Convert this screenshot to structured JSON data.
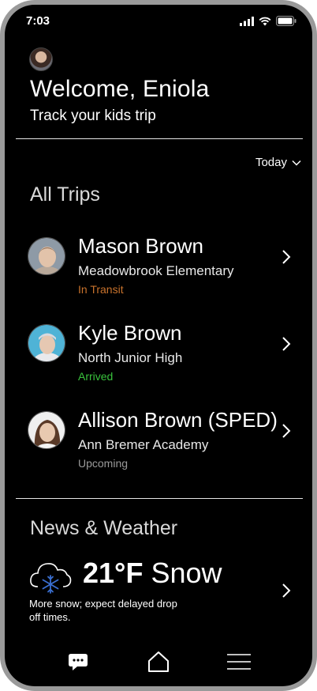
{
  "status_bar": {
    "time": "7:03"
  },
  "header": {
    "welcome": "Welcome, Eniola",
    "subtitle": "Track your kids trip"
  },
  "filter": {
    "label": "Today"
  },
  "trips_section": {
    "title": "All Trips",
    "trips": [
      {
        "name": "Mason Brown",
        "school": "Meadowbrook Elementary",
        "status": "In Transit",
        "status_color": "#c8722c"
      },
      {
        "name": "Kyle Brown",
        "school": "North Junior High",
        "status": "Arrived",
        "status_color": "#39c23c"
      },
      {
        "name": "Allison Brown (SPED)",
        "school": "Ann Bremer Academy",
        "status": "Upcoming",
        "status_color": "#9a9a9a"
      }
    ]
  },
  "news_section": {
    "title": "News & Weather",
    "weather": {
      "temperature": "21°F",
      "condition": "Snow",
      "description": "More snow; expect delayed drop off times.",
      "icon": "cloud-snow-icon"
    }
  },
  "bottom_nav": {
    "items": [
      {
        "icon": "chat-icon"
      },
      {
        "icon": "home-icon"
      },
      {
        "icon": "menu-icon"
      }
    ]
  },
  "colors": {
    "background": "#000000",
    "in_transit": "#c8722c",
    "arrived": "#39c23c",
    "upcoming": "#9a9a9a",
    "snowflake": "#3a6fd1"
  }
}
